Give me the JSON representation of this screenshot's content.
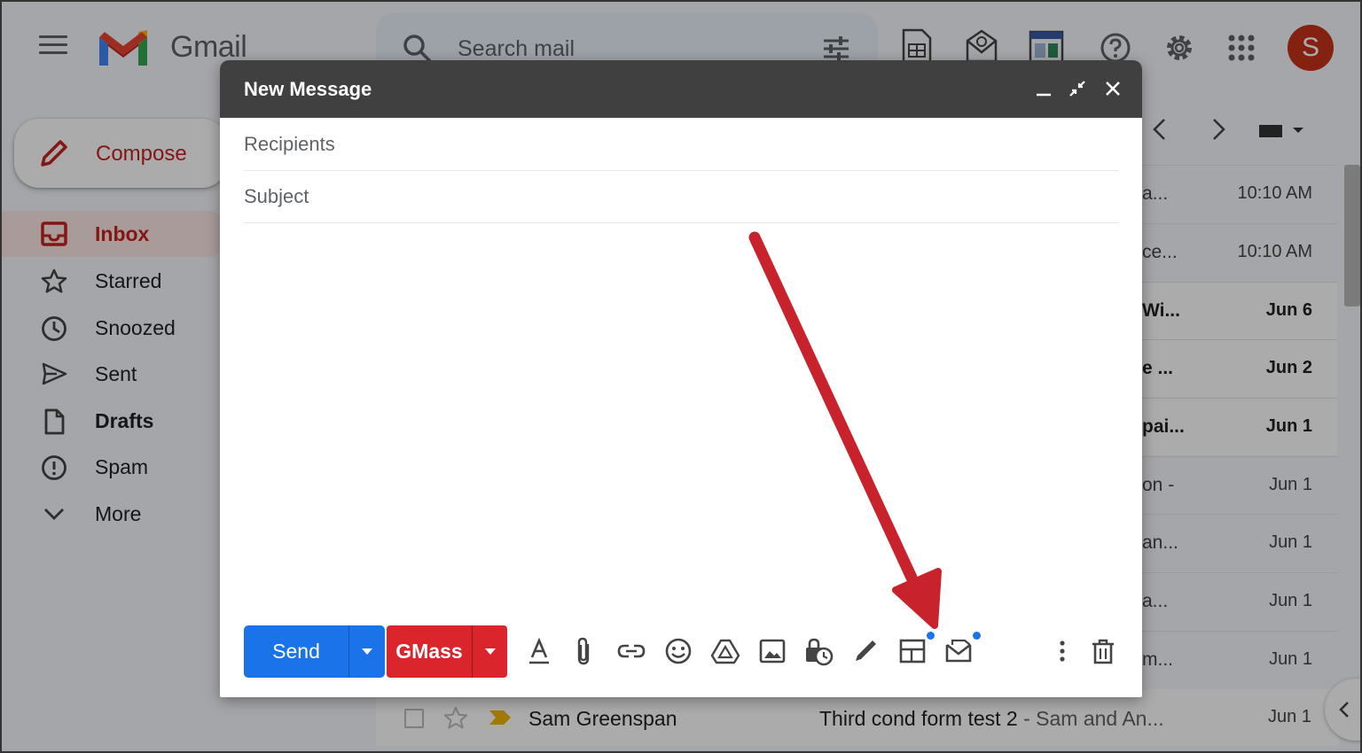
{
  "app": {
    "name": "Gmail"
  },
  "search": {
    "placeholder": "Search mail"
  },
  "user": {
    "avatar_letter": "S",
    "avatar_color": "#c5321a"
  },
  "sidebar": {
    "compose_label": "Compose",
    "items": [
      {
        "label": "Inbox",
        "icon": "inbox-icon",
        "active": true
      },
      {
        "label": "Starred",
        "icon": "star-icon"
      },
      {
        "label": "Snoozed",
        "icon": "clock-icon"
      },
      {
        "label": "Sent",
        "icon": "send-icon"
      },
      {
        "label": "Drafts",
        "icon": "draft-icon",
        "bold": true
      },
      {
        "label": "Spam",
        "icon": "spam-icon"
      },
      {
        "label": "More",
        "icon": "chevron-down-icon"
      }
    ]
  },
  "email_list": {
    "rows": [
      {
        "snippet": "a...",
        "time": "10:10 AM",
        "bold": false
      },
      {
        "snippet": "ce...",
        "time": "10:10 AM",
        "bold": false
      },
      {
        "snippet": "Wi...",
        "time": "Jun 6",
        "bold": true
      },
      {
        "snippet": "e ...",
        "time": "Jun 2",
        "bold": true
      },
      {
        "snippet": "pai...",
        "time": "Jun 1",
        "bold": true
      },
      {
        "snippet": "on -",
        "time": "Jun 1",
        "bold": false
      },
      {
        "snippet": "an...",
        "time": "Jun 1",
        "bold": false
      },
      {
        "snippet": "a...",
        "time": "Jun 1",
        "bold": false
      },
      {
        "snippet": "m...",
        "time": "Jun 1",
        "bold": false
      }
    ],
    "last_row": {
      "sender": "Sam Greenspan",
      "subject": "Third cond form test 2",
      "snippet": " - Sam and An...",
      "time": "Jun 1"
    }
  },
  "compose": {
    "title": "New Message",
    "recipients_placeholder": "Recipients",
    "subject_placeholder": "Subject",
    "send_label": "Send",
    "gmass_label": "GMass",
    "toolbar_icons": [
      "text-format-icon",
      "attach-icon",
      "link-icon",
      "emoji-icon",
      "drive-icon",
      "photo-icon",
      "confidential-icon",
      "signature-icon",
      "layout-icon",
      "gmass-email-icon"
    ]
  },
  "colors": {
    "send": "#1a73e8",
    "gmass": "#d9252b",
    "header": "#404040",
    "annotation_arrow": "#c8232c",
    "accent_red": "#c5221f"
  }
}
